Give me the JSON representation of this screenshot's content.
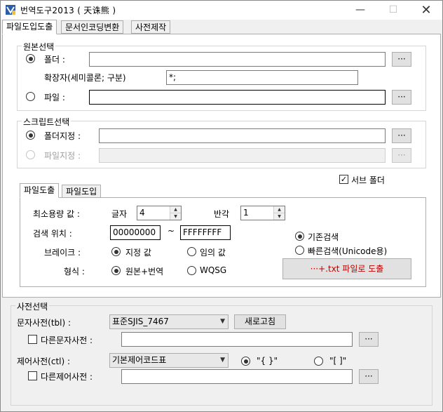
{
  "window": {
    "title": "번역도구2013 ( 天诛熊 )",
    "min_glyph": "—",
    "max_glyph": "☐",
    "close_glyph": "✕"
  },
  "tabs": [
    "파일도입도출",
    "문서인코딩변환",
    "사전제작"
  ],
  "source": {
    "group_title": "원본선택",
    "folder_label": "폴더 :",
    "folder_value": "",
    "ext_label": "확장자(세미콜론; 구분)",
    "ext_value": "*;",
    "file_label": "파일 :",
    "file_value": "",
    "browse": "···"
  },
  "script": {
    "group_title": "스크립트선택",
    "folder_label": "폴더지정 :",
    "file_label": "파일지정 :",
    "folder_value": "",
    "file_value": "",
    "browse": "···"
  },
  "subfolder_label": "서브 폴더",
  "inner_tabs": [
    "파일도출",
    "파일도입"
  ],
  "export": {
    "min_size_label": "최소용량 값 :",
    "char_label": "글자",
    "char_value": "4",
    "halfwidth_label": "반각",
    "halfwidth_value": "1",
    "search_pos_label": "검색 위치 :",
    "start_value": "00000000",
    "tilde": "~",
    "end_value": "FFFFFFFF",
    "break_label": "브레이크 :",
    "break_fixed": "지정 값",
    "break_any": "임의 값",
    "format_label": "형식 :",
    "format_orig": "원본+번역",
    "format_wqsg": "WQSG",
    "search_existing": "기존검색",
    "search_fast": "빠른검색(Unicode용)",
    "export_button": "···+.txt 파일로 도출"
  },
  "dict": {
    "group_title": "사전선택",
    "char_dict_label": "문자사전(tbl) :",
    "char_dict_value": "표준SJIS_7467",
    "refresh": "새로고침",
    "other_char_dict_label": "다른문자사전 :",
    "other_char_dict_value": "",
    "ctrl_dict_label": "제어사전(ctl) :",
    "ctrl_dict_value": "기본제어코드표",
    "brace_opt": "\"{ }\"",
    "bracket_opt": "\"[ ]\"",
    "other_ctrl_dict_label": "다른제어사전 :",
    "other_ctrl_dict_value": "",
    "browse": "···"
  },
  "colors": {
    "accent_red": "#c00000"
  }
}
